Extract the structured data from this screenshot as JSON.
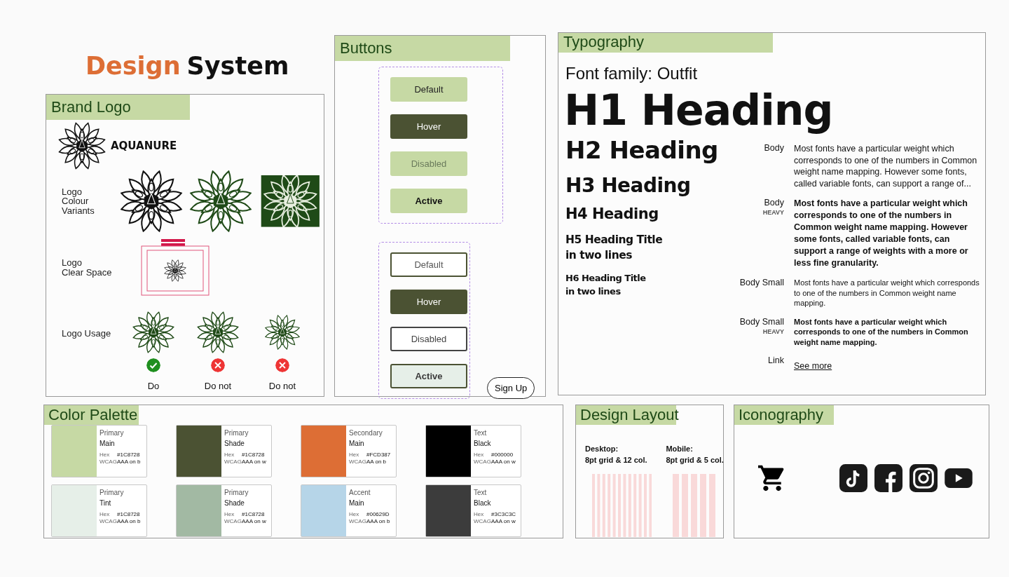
{
  "title": {
    "accent": "Design",
    "rest": "System"
  },
  "brand_logo": {
    "heading": "Brand Logo",
    "wordmark": "AQUANURE",
    "variants_label": "Logo\nColour\nVariants",
    "variants": [
      {
        "kind": "black"
      },
      {
        "kind": "green"
      },
      {
        "kind": "inverse"
      }
    ],
    "clear_space_label": "Logo\nClear Space",
    "usage_label": "Logo Usage",
    "usage": [
      {
        "allowed": true,
        "label": "Do"
      },
      {
        "allowed": false,
        "label": "Do not"
      },
      {
        "allowed": false,
        "label": "Do not"
      }
    ]
  },
  "buttons": {
    "heading": "Buttons",
    "groups": [
      {
        "kind": "filled",
        "items": [
          {
            "kind": "default",
            "label": "Default"
          },
          {
            "kind": "hover",
            "label": "Hover"
          },
          {
            "kind": "disabled",
            "label": "Disabled"
          },
          {
            "kind": "active",
            "label": "Active"
          }
        ]
      },
      {
        "kind": "outline",
        "items": [
          {
            "kind": "default",
            "label": "Default"
          },
          {
            "kind": "hover",
            "label": "Hover"
          },
          {
            "kind": "disabled",
            "label": "Disabled"
          },
          {
            "kind": "active",
            "label": "Active"
          }
        ]
      }
    ],
    "pill": "Sign Up"
  },
  "typography": {
    "heading": "Typography",
    "font_family": "Font family: Outfit",
    "headings": [
      {
        "kind": "h1",
        "text": "H1 Heading"
      },
      {
        "kind": "h2",
        "text": "H2 Heading"
      },
      {
        "kind": "h3",
        "text": "H3 Heading"
      },
      {
        "kind": "h4",
        "text": "H4 Heading"
      },
      {
        "kind": "h5",
        "text": "H5 Heading Title\nin two lines"
      },
      {
        "kind": "h6",
        "text": "H6 Heading Title\nin two lines"
      }
    ],
    "samples": [
      {
        "kind": "body",
        "label": "Body",
        "text": "Most fonts have a particular weight which corresponds to one of the numbers in Common weight name mapping. However some fonts, called variable fonts, can support a range of..."
      },
      {
        "kind": "body-heavy",
        "label": "Body",
        "tag": "HEAVY",
        "text": "Most fonts have a particular weight which corresponds to one of the numbers in Common weight name mapping. However some fonts, called variable fonts, can support a range of weights with a more or less fine granularity."
      },
      {
        "kind": "small",
        "label": "Body Small",
        "text": "Most fonts have a particular weight which corresponds to one of the numbers in Common weight name mapping."
      },
      {
        "kind": "small-heavy",
        "label": "Body Small",
        "tag": "HEAVY",
        "text": "Most fonts have a particular weight which corresponds to one of the numbers in Common weight name mapping."
      },
      {
        "kind": "link",
        "label": "Link",
        "text": "See more"
      }
    ]
  },
  "color_palette": {
    "heading": "Color Palette",
    "cards": [
      {
        "color": "#c6d9a4",
        "group": "Primary",
        "name": "Main",
        "hex_label": "Hex",
        "hex": "#1C8728",
        "wcag_label": "WCAG",
        "wcag": "AAA on b"
      },
      {
        "color": "#4b5233",
        "group": "Primary",
        "name": "Shade",
        "hex_label": "Hex",
        "hex": "#1C8728",
        "wcag_label": "WCAG",
        "wcag": "AAA on w"
      },
      {
        "color": "#dd6e35",
        "group": "Secondary",
        "name": "Main",
        "hex_label": "Hex",
        "hex": "#FCD387",
        "wcag_label": "WCAG",
        "wcag": "AA on b"
      },
      {
        "color": "#000000",
        "group": "Text",
        "name": "Black",
        "hex_label": "Hex",
        "hex": "#000000",
        "wcag_label": "WCAG",
        "wcag": "AAA on w"
      },
      {
        "color": "#e6efe8",
        "group": "Primary",
        "name": "Tint",
        "hex_label": "Hex",
        "hex": "#1C8728",
        "wcag_label": "WCAG",
        "wcag": "AAA on b"
      },
      {
        "color": "#a2b9a3",
        "group": "Primary",
        "name": "Shade",
        "hex_label": "Hex",
        "hex": "#1C8728",
        "wcag_label": "WCAG",
        "wcag": "AAA on w"
      },
      {
        "color": "#b6d5e8",
        "group": "Accent",
        "name": "Main",
        "hex_label": "Hex",
        "hex": "#00629D",
        "wcag_label": "WCAG",
        "wcag": "AAA on b"
      },
      {
        "color": "#3c3c3c",
        "group": "Text",
        "name": "Black",
        "hex_label": "Hex",
        "hex": "#3C3C3C",
        "wcag_label": "WCAG",
        "wcag": "AAA on w"
      }
    ]
  },
  "design_layout": {
    "heading": "Design Layout",
    "grids": [
      {
        "kind": "desktop",
        "title": "Desktop:",
        "detail": "8pt grid & 12 col."
      },
      {
        "kind": "mobile",
        "title": "Mobile:",
        "detail": "8pt grid & 5 col."
      }
    ]
  },
  "iconography": {
    "heading": "Iconography",
    "icons": [
      {
        "kind": "cart"
      },
      {
        "kind": "tiktok"
      },
      {
        "kind": "facebook"
      },
      {
        "kind": "instagram"
      },
      {
        "kind": "youtube"
      }
    ]
  }
}
